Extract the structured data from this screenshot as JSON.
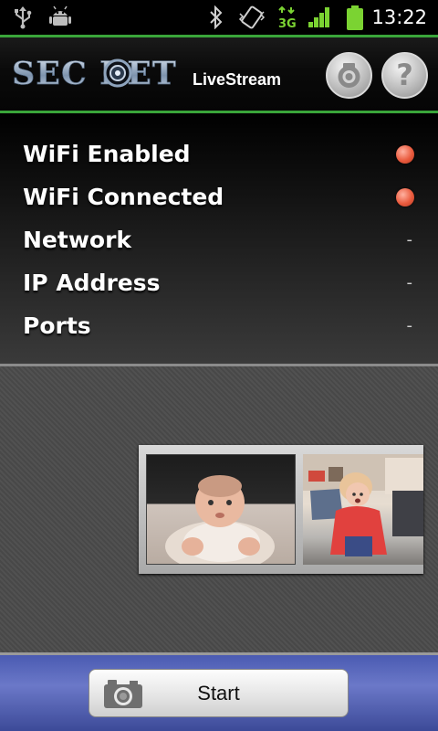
{
  "status_bar": {
    "time": "13:22",
    "icons": [
      "usb-icon",
      "android-debug-icon",
      "bluetooth-icon",
      "vibrate-icon",
      "3g-data-icon",
      "signal-icon",
      "battery-icon"
    ],
    "network_type": "3G"
  },
  "header": {
    "logo_text": "SEC RET",
    "logo_subtitle": "LiveStream",
    "settings_icon": "camera-shutter-icon",
    "help_glyph": "?"
  },
  "status_rows": [
    {
      "label": "WiFi Enabled",
      "indicator": "red-dot"
    },
    {
      "label": "WiFi Connected",
      "indicator": "red-dot"
    },
    {
      "label": "Network",
      "value": "-"
    },
    {
      "label": "IP Address",
      "value": "-"
    },
    {
      "label": "Ports",
      "value": "-"
    }
  ],
  "thumbnails": [
    "baby-photo",
    "child-photo"
  ],
  "bottom": {
    "start_label": "Start",
    "start_icon": "camera-icon"
  },
  "colors": {
    "header_border": "#3aa53a",
    "indicator": "#ea5b3e",
    "bottom_bar": "#5565bd"
  }
}
